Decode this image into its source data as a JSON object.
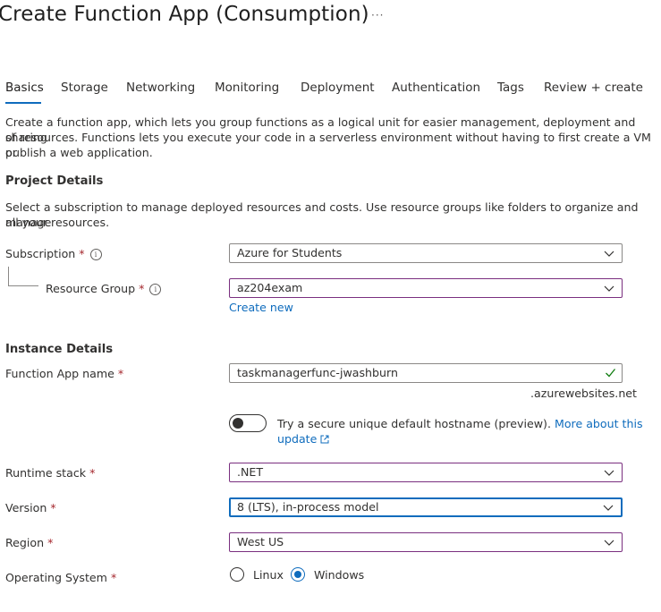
{
  "page": {
    "title": "Create Function App (Consumption)",
    "more": "···"
  },
  "tabs": [
    {
      "label": "Basics"
    },
    {
      "label": "Storage"
    },
    {
      "label": "Networking"
    },
    {
      "label": "Monitoring"
    },
    {
      "label": "Deployment"
    },
    {
      "label": "Authentication"
    },
    {
      "label": "Tags"
    },
    {
      "label": "Review + create"
    }
  ],
  "intro": {
    "line1": "Create a function app, which lets you group functions as a logical unit for easier management, deployment and sharing",
    "line2": "of resources. Functions lets you execute your code in a serverless environment without having to first create a VM or",
    "line3": "publish a web application."
  },
  "project": {
    "heading": "Project Details",
    "desc1": "Select a subscription to manage deployed resources and costs. Use resource groups like folders to organize and manage",
    "desc2": "all your resources.",
    "subscription_label": "Subscription",
    "subscription_value": "Azure for Students",
    "rg_label": "Resource Group",
    "rg_value": "az204exam",
    "create_new": "Create new"
  },
  "instance": {
    "heading": "Instance Details",
    "name_label": "Function App name",
    "name_value": "taskmanagerfunc-jwashburn",
    "suffix": ".azurewebsites.net",
    "hostname_text": "Try a secure unique default hostname (preview).",
    "hostname_link1": "More about this",
    "hostname_link2": "update",
    "runtime_label": "Runtime stack",
    "runtime_value": ".NET",
    "version_label": "Version",
    "version_value": "8 (LTS), in-process model",
    "region_label": "Region",
    "region_value": "West US",
    "os_label": "Operating System",
    "os_linux": "Linux",
    "os_windows": "Windows",
    "os_selected": "Windows"
  },
  "required_mark": "*",
  "info_glyph": "i",
  "colors": {
    "accent": "#0f6cbd",
    "required": "#a4262c",
    "invalid_border": "#7a2f7f",
    "valid_check": "#107c10"
  }
}
